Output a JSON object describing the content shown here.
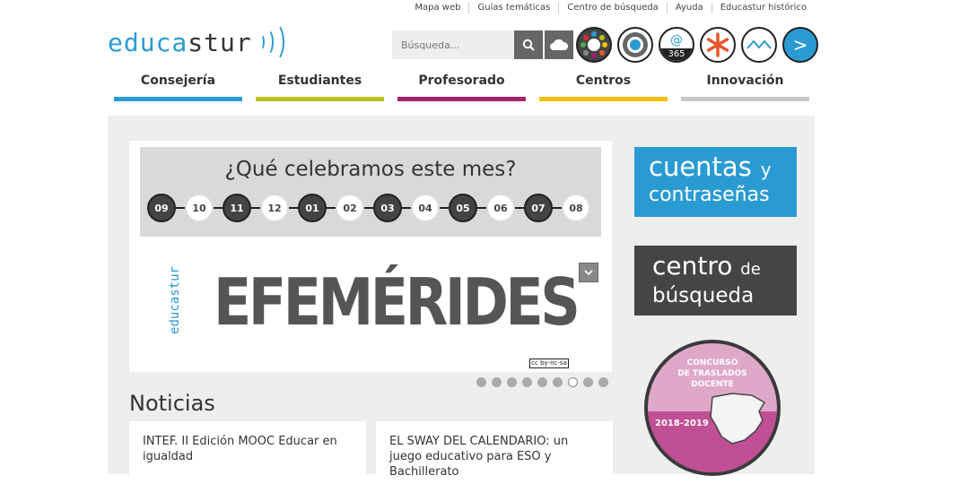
{
  "top_links": [
    "Mapa web",
    "Guías temáticas",
    "Centro de búsqueda",
    "Ayuda",
    "Educastur histórico"
  ],
  "logo": {
    "part1": "educa",
    "part2": "stur"
  },
  "search": {
    "placeholder": "Búsqueda..."
  },
  "nav": [
    {
      "label": "Consejería",
      "color": "#2a9bd2"
    },
    {
      "label": "Estudiantes",
      "color": "#b8c21a"
    },
    {
      "label": "Profesorado",
      "color": "#a0266b"
    },
    {
      "label": "Centros",
      "color": "#f2c200"
    },
    {
      "label": "Innovación",
      "color": "#c8c8c8"
    }
  ],
  "circle_icons": [
    "palette-icon",
    "ring-icon",
    "office365-icon",
    "asterisk-icon",
    "wave-icon",
    "next-icon"
  ],
  "office365_label": "365",
  "next_label": ">",
  "slider": {
    "title": "¿Qué celebramos este mes?",
    "dates": [
      "09",
      "10",
      "11",
      "12",
      "01",
      "02",
      "03",
      "04",
      "05",
      "06",
      "07",
      "08"
    ],
    "vertical_logo": "educastur",
    "headline": "EFEMÉRIDES",
    "license": "cc by-nc-sa",
    "dots_count": 9,
    "active_dot": 6
  },
  "noticias": {
    "title": "Noticias",
    "cards": [
      "INTEF. II Edición MOOC Educar en igualdad",
      "EL SWAY DEL CALENDARIO: un juego educativo para ESO y Bachillerato"
    ]
  },
  "cuentas": {
    "l1": "cuentas",
    "l1b": "y",
    "l2": "contraseñas"
  },
  "centro": {
    "l1": "centro",
    "l1b": "de",
    "l2": "búsqueda"
  },
  "concurso": {
    "text": "CONCURSO\nDE TRASLADOS\nDOCENTE",
    "year": "2018-2019"
  }
}
